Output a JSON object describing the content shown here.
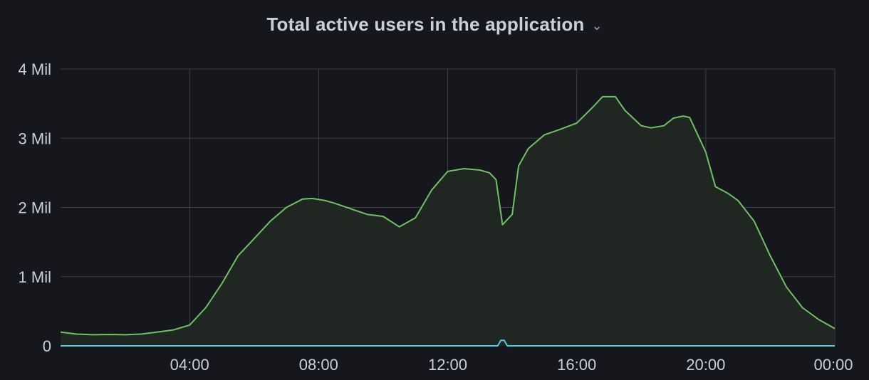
{
  "panel": {
    "title": "Total active users in the application",
    "menu_icon": "chevron-down-icon"
  },
  "chart_data": {
    "type": "area",
    "title": "Total active users in the application",
    "xlabel": "",
    "ylabel": "",
    "x_ticks": [
      "04:00",
      "08:00",
      "12:00",
      "16:00",
      "20:00",
      "00:00"
    ],
    "y_ticks": [
      "0",
      "1 Mil",
      "2 Mil",
      "3 Mil",
      "4 Mil"
    ],
    "xlim": [
      0,
      24
    ],
    "ylim": [
      0,
      4000000
    ],
    "grid": true,
    "colors": {
      "background": "#16171c",
      "grid": "#3d3f45",
      "line_green": "#73bf69",
      "fill_green": "#202621",
      "line_blue": "#5ac8e0",
      "text": "#c7d0d9"
    },
    "series": [
      {
        "color": "#73bf69",
        "fill": true,
        "x": [
          0,
          0.5,
          1,
          1.5,
          2,
          2.5,
          3,
          3.5,
          4,
          4.5,
          5,
          5.5,
          6,
          6.5,
          7,
          7.5,
          7.8,
          8.2,
          8.5,
          9,
          9.5,
          10,
          10.5,
          11,
          11.5,
          12,
          12.5,
          13,
          13.3,
          13.5,
          13.7,
          14,
          14.2,
          14.5,
          15,
          15.5,
          16,
          16.5,
          16.8,
          17.2,
          17.5,
          18,
          18.3,
          18.7,
          19,
          19.3,
          19.5,
          20,
          20.3,
          20.7,
          21,
          21.5,
          22,
          22.5,
          23,
          23.5,
          24
        ],
        "y": [
          200000,
          170000,
          160000,
          165000,
          160000,
          170000,
          200000,
          230000,
          300000,
          550000,
          900000,
          1300000,
          1550000,
          1800000,
          2000000,
          2120000,
          2130000,
          2100000,
          2060000,
          1980000,
          1900000,
          1870000,
          1720000,
          1850000,
          2250000,
          2520000,
          2560000,
          2540000,
          2500000,
          2400000,
          1750000,
          1900000,
          2600000,
          2850000,
          3050000,
          3130000,
          3220000,
          3450000,
          3600000,
          3600000,
          3400000,
          3180000,
          3150000,
          3180000,
          3290000,
          3320000,
          3300000,
          2800000,
          2300000,
          2200000,
          2100000,
          1800000,
          1300000,
          850000,
          550000,
          380000,
          250000
        ]
      },
      {
        "color": "#5ac8e0",
        "fill": false,
        "x": [
          0,
          13.55,
          13.65,
          13.75,
          13.85,
          24
        ],
        "y": [
          0,
          0,
          80000,
          80000,
          0,
          0
        ]
      }
    ]
  }
}
